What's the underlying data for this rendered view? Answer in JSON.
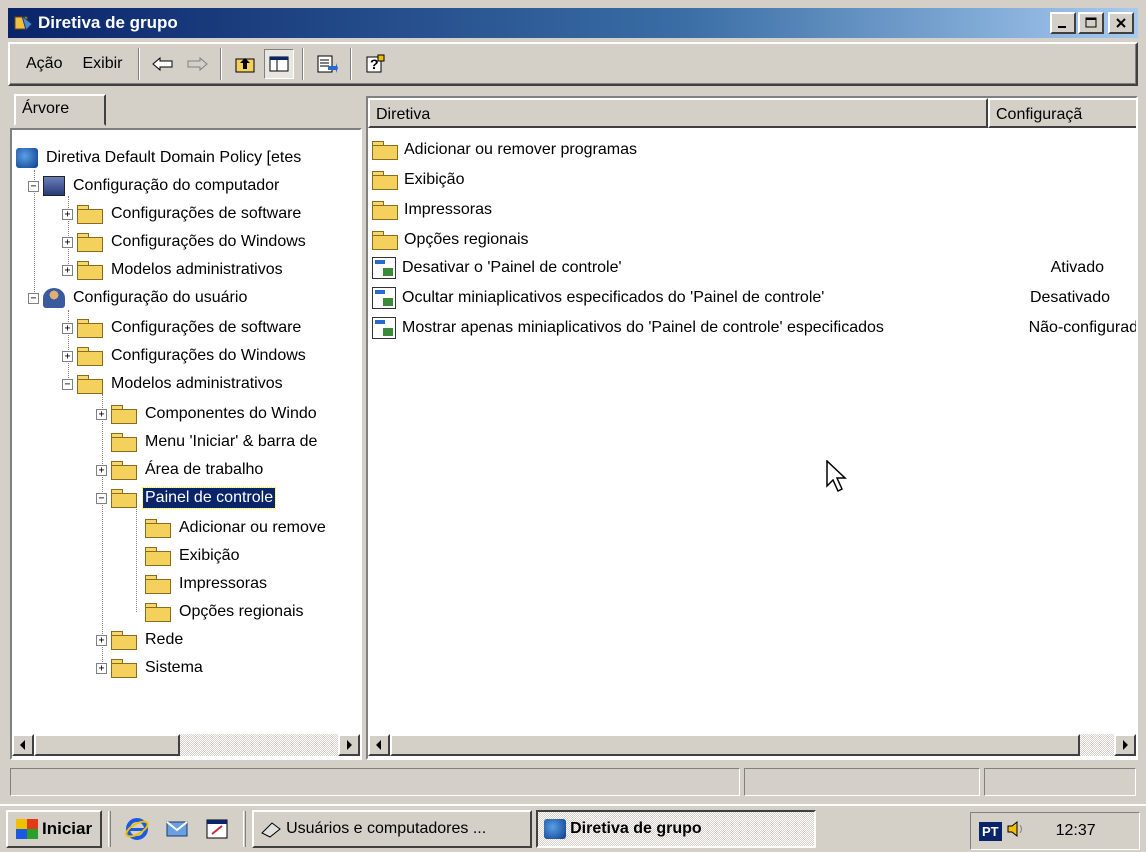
{
  "window": {
    "title": "Diretiva de grupo",
    "buttons": {
      "minimize": "_",
      "maximize": "□",
      "close": "✕"
    }
  },
  "menubar": {
    "items": [
      {
        "label": "Ação",
        "accel": "A"
      },
      {
        "label": "Exibir",
        "accel": "E"
      }
    ]
  },
  "toolbar": {
    "icons": [
      "back-arrow-icon",
      "forward-arrow-icon",
      "up-folder-icon",
      "show-tree-icon",
      "export-list-icon",
      "help-icon"
    ]
  },
  "tree": {
    "tab_label": "Árvore",
    "root": "Diretiva Default Domain Policy [etes",
    "nodes": [
      "Configuração do computador",
      "Configurações de software",
      "Configurações do Windows",
      "Modelos administrativos",
      "Configuração do usuário",
      "Configurações de software",
      "Configurações do Windows",
      "Modelos administrativos",
      "Componentes do Windo",
      "Menu 'Iniciar' & barra de",
      "Área de trabalho",
      "Painel de controle",
      "Adicionar ou remove",
      "Exibição",
      "Impressoras",
      "Opções regionais",
      "Rede",
      "Sistema"
    ],
    "selected": "Painel de controle"
  },
  "list": {
    "columns": [
      "Diretiva",
      "Configuraçã"
    ],
    "rows": [
      {
        "name": "Adicionar ou remover programas",
        "setting": "",
        "type": "folder"
      },
      {
        "name": "Exibição",
        "setting": "",
        "type": "folder"
      },
      {
        "name": "Impressoras",
        "setting": "",
        "type": "folder"
      },
      {
        "name": "Opções regionais",
        "setting": "",
        "type": "folder"
      },
      {
        "name": "Desativar o 'Painel de controle'",
        "setting": "Ativado",
        "type": "policy"
      },
      {
        "name": "Ocultar miniaplicativos especificados do 'Painel de controle'",
        "setting": "Desativado",
        "type": "policy"
      },
      {
        "name": "Mostrar apenas miniaplicativos do 'Painel de controle' especificados",
        "setting": "Não-configurad",
        "type": "policy"
      }
    ]
  },
  "taskbar": {
    "start_label": "Iniciar",
    "tasks": [
      {
        "label": "Usuários e computadores ...",
        "active": false
      },
      {
        "label": "Diretiva de grupo",
        "active": true
      }
    ],
    "tray": {
      "lang": "PT",
      "clock": "12:37"
    }
  }
}
